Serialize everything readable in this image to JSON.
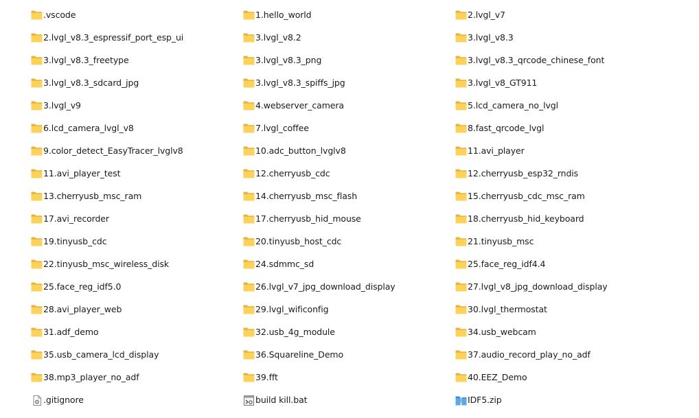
{
  "colors": {
    "folder_back": "#E8B33A",
    "folder_front": "#FCD25A",
    "text": "#1a1a1a",
    "background": "#ffffff"
  },
  "items": [
    {
      "name": ".vscode",
      "type": "folder",
      "icon": "folder-icon"
    },
    {
      "name": "1.hello_world",
      "type": "folder",
      "icon": "folder-icon"
    },
    {
      "name": "2.lvgl_v7",
      "type": "folder",
      "icon": "folder-icon"
    },
    {
      "name": "2.lvgl_v8.3_espressif_port_esp_ui",
      "type": "folder",
      "icon": "folder-icon"
    },
    {
      "name": "3.lvgl_v8.2",
      "type": "folder",
      "icon": "folder-icon"
    },
    {
      "name": "3.lvgl_v8.3",
      "type": "folder",
      "icon": "folder-icon"
    },
    {
      "name": "3.lvgl_v8.3_freetype",
      "type": "folder",
      "icon": "folder-icon"
    },
    {
      "name": "3.lvgl_v8.3_png",
      "type": "folder",
      "icon": "folder-icon"
    },
    {
      "name": "3.lvgl_v8.3_qrcode_chinese_font",
      "type": "folder",
      "icon": "folder-icon"
    },
    {
      "name": "3.lvgl_v8.3_sdcard_jpg",
      "type": "folder",
      "icon": "folder-icon"
    },
    {
      "name": "3.lvgl_v8.3_spiffs_jpg",
      "type": "folder",
      "icon": "folder-icon"
    },
    {
      "name": "3.lvgl_v8_GT911",
      "type": "folder",
      "icon": "folder-icon"
    },
    {
      "name": "3.lvgl_v9",
      "type": "folder",
      "icon": "folder-icon"
    },
    {
      "name": "4.webserver_camera",
      "type": "folder",
      "icon": "folder-icon"
    },
    {
      "name": "5.lcd_camera_no_lvgl",
      "type": "folder",
      "icon": "folder-icon"
    },
    {
      "name": "6.lcd_camera_lvgl_v8",
      "type": "folder",
      "icon": "folder-icon"
    },
    {
      "name": "7.lvgl_coffee",
      "type": "folder",
      "icon": "folder-icon"
    },
    {
      "name": "8.fast_qrcode_lvgl",
      "type": "folder",
      "icon": "folder-icon"
    },
    {
      "name": "9.color_detect_EasyTracer_lvglv8",
      "type": "folder",
      "icon": "folder-icon"
    },
    {
      "name": "10.adc_button_lvglv8",
      "type": "folder",
      "icon": "folder-icon"
    },
    {
      "name": "11.avi_player",
      "type": "folder",
      "icon": "folder-icon"
    },
    {
      "name": "11.avi_player_test",
      "type": "folder",
      "icon": "folder-icon"
    },
    {
      "name": "12.cherryusb_cdc",
      "type": "folder",
      "icon": "folder-icon"
    },
    {
      "name": "12.cherryusb_esp32_rndis",
      "type": "folder",
      "icon": "folder-icon"
    },
    {
      "name": "13.cherryusb_msc_ram",
      "type": "folder",
      "icon": "folder-icon"
    },
    {
      "name": "14.cherryusb_msc_flash",
      "type": "folder",
      "icon": "folder-icon"
    },
    {
      "name": "15.cherryusb_cdc_msc_ram",
      "type": "folder",
      "icon": "folder-icon"
    },
    {
      "name": "17.avi_recorder",
      "type": "folder",
      "icon": "folder-icon"
    },
    {
      "name": "17.cherryusb_hid_mouse",
      "type": "folder",
      "icon": "folder-icon"
    },
    {
      "name": "18.cherryusb_hid_keyboard",
      "type": "folder",
      "icon": "folder-icon"
    },
    {
      "name": "19.tinyusb_cdc",
      "type": "folder",
      "icon": "folder-icon"
    },
    {
      "name": "20.tinyusb_host_cdc",
      "type": "folder",
      "icon": "folder-icon"
    },
    {
      "name": "21.tinyusb_msc",
      "type": "folder",
      "icon": "folder-icon"
    },
    {
      "name": "22.tinyusb_msc_wireless_disk",
      "type": "folder",
      "icon": "folder-icon"
    },
    {
      "name": "24.sdmmc_sd",
      "type": "folder",
      "icon": "folder-icon"
    },
    {
      "name": "25.face_reg_idf4.4",
      "type": "folder",
      "icon": "folder-icon"
    },
    {
      "name": "25.face_reg_idf5.0",
      "type": "folder",
      "icon": "folder-icon"
    },
    {
      "name": "26.lvgl_v7_jpg_download_display",
      "type": "folder",
      "icon": "folder-icon"
    },
    {
      "name": "27.lvgl_v8_jpg_download_display",
      "type": "folder",
      "icon": "folder-icon"
    },
    {
      "name": "28.avi_player_web",
      "type": "folder",
      "icon": "folder-icon"
    },
    {
      "name": "29.lvgl_wificonfig",
      "type": "folder",
      "icon": "folder-icon"
    },
    {
      "name": "30.lvgl_thermostat",
      "type": "folder",
      "icon": "folder-icon"
    },
    {
      "name": "31.adf_demo",
      "type": "folder",
      "icon": "folder-icon"
    },
    {
      "name": "32.usb_4g_module",
      "type": "folder",
      "icon": "folder-icon"
    },
    {
      "name": "34.usb_webcam",
      "type": "folder",
      "icon": "folder-icon"
    },
    {
      "name": "35.usb_camera_lcd_display",
      "type": "folder",
      "icon": "folder-icon"
    },
    {
      "name": "36.Squareline_Demo",
      "type": "folder",
      "icon": "folder-icon"
    },
    {
      "name": "37.audio_record_play_no_adf",
      "type": "folder",
      "icon": "folder-icon"
    },
    {
      "name": "38.mp3_player_no_adf",
      "type": "folder",
      "icon": "folder-icon"
    },
    {
      "name": "39.fft",
      "type": "folder",
      "icon": "folder-icon"
    },
    {
      "name": "40.EEZ_Demo",
      "type": "folder",
      "icon": "folder-icon"
    },
    {
      "name": ".gitignore",
      "type": "file",
      "icon": "gear-file-icon"
    },
    {
      "name": "build kill.bat",
      "type": "bat",
      "icon": "batch-file-icon"
    },
    {
      "name": "IDF5.zip",
      "type": "zip",
      "icon": "zip-archive-icon"
    }
  ]
}
